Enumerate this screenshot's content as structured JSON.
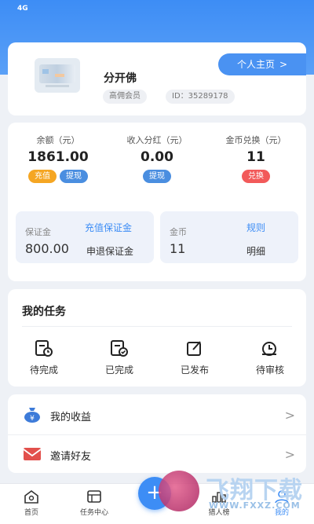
{
  "status_bar": {
    "signal": "4G"
  },
  "profile": {
    "name": "分开佛",
    "member_tag": "高佣会员",
    "id_tag": "ID：35289178",
    "home_button": "个人主页",
    "home_arrow": ">"
  },
  "wallet": {
    "balance": {
      "label": "余额（元）",
      "value": "1861.00",
      "actions": [
        "充值",
        "提现"
      ]
    },
    "dividend": {
      "label": "收入分红（元）",
      "value": "0.00",
      "actions": [
        "提现"
      ]
    },
    "coins": {
      "label": "金币兑换（元）",
      "value": "11",
      "actions": [
        "兑换"
      ]
    },
    "deposit": {
      "label": "保证金",
      "link": "充值保证金",
      "value": "800.00",
      "action": "申退保证金"
    },
    "coin_box": {
      "label": "金币",
      "link": "规则",
      "value": "11",
      "action": "明细"
    }
  },
  "tasks": {
    "title": "我的任务",
    "items": [
      {
        "label": "待完成",
        "icon": "task-pending-icon"
      },
      {
        "label": "已完成",
        "icon": "task-done-icon"
      },
      {
        "label": "已发布",
        "icon": "task-published-icon"
      },
      {
        "label": "待审核",
        "icon": "task-review-icon"
      }
    ]
  },
  "menu": {
    "items": [
      {
        "label": "我的收益",
        "icon": "money-bag-icon"
      },
      {
        "label": "邀请好友",
        "icon": "envelope-icon"
      }
    ],
    "chevron": ">"
  },
  "tabbar": {
    "items": [
      {
        "label": "首页",
        "icon": "home-icon"
      },
      {
        "label": "任务中心",
        "icon": "task-center-icon"
      },
      {
        "label": "猎人榜",
        "icon": "ranking-icon"
      },
      {
        "label": "我的",
        "icon": "profile-icon"
      }
    ],
    "fab": "+"
  },
  "watermark": {
    "brand": "飞翔下载",
    "url": "WWW.FXXZ.COM"
  },
  "colors": {
    "primary": "#3d8df5",
    "orange": "#f5a623",
    "blue": "#4a8ee0",
    "red": "#f25a5a"
  }
}
